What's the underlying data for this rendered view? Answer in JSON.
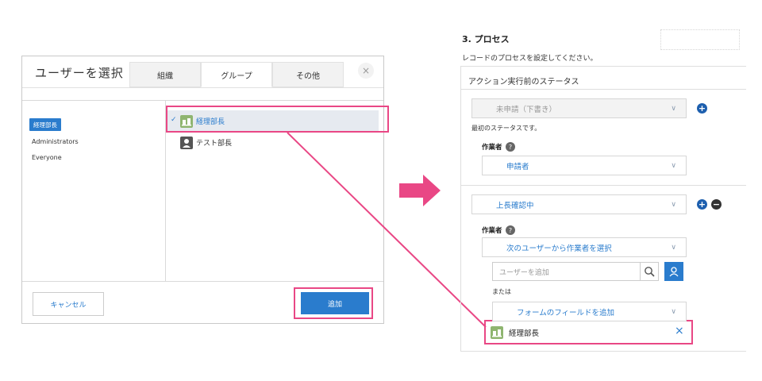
{
  "dialog": {
    "title": "ユーザーを選択",
    "tabs": [
      "組織",
      "グループ",
      "その他"
    ],
    "active_tab": "グループ",
    "close_glyph": "×",
    "groups": [
      "経理部長",
      "Administrators",
      "Everyone"
    ],
    "selected_group": "経理部長",
    "members": [
      {
        "label": "経理部長",
        "checked": true
      },
      {
        "label": "テスト部長",
        "checked": false
      }
    ],
    "check_glyph": "✓",
    "cancel_label": "キャンセル",
    "add_label": "追加"
  },
  "process": {
    "title": "3. プロセス",
    "description": "レコードのプロセスを設定してください。",
    "panel_header": "アクション実行前のステータス",
    "status1": "未申請（下書き）",
    "status1_note": "最初のステータスです。",
    "operator_label": "作業者",
    "help_glyph": "?",
    "op1_value": "申請者",
    "status2": "上長確認中",
    "op2_value": "次のユーザーから作業者を選択",
    "user_search_placeholder": "ユーザーを追加",
    "or_label": "または",
    "field_select": "フォームのフィールドを追加",
    "result_label": "経理部長",
    "remove_glyph": "×",
    "plus_glyph": "+",
    "minus_glyph": "−",
    "chevron_glyph": "∨"
  },
  "colors": {
    "accent": "#2a7ccd",
    "highlight": "#e94785",
    "group_icon": "#8fb570"
  }
}
